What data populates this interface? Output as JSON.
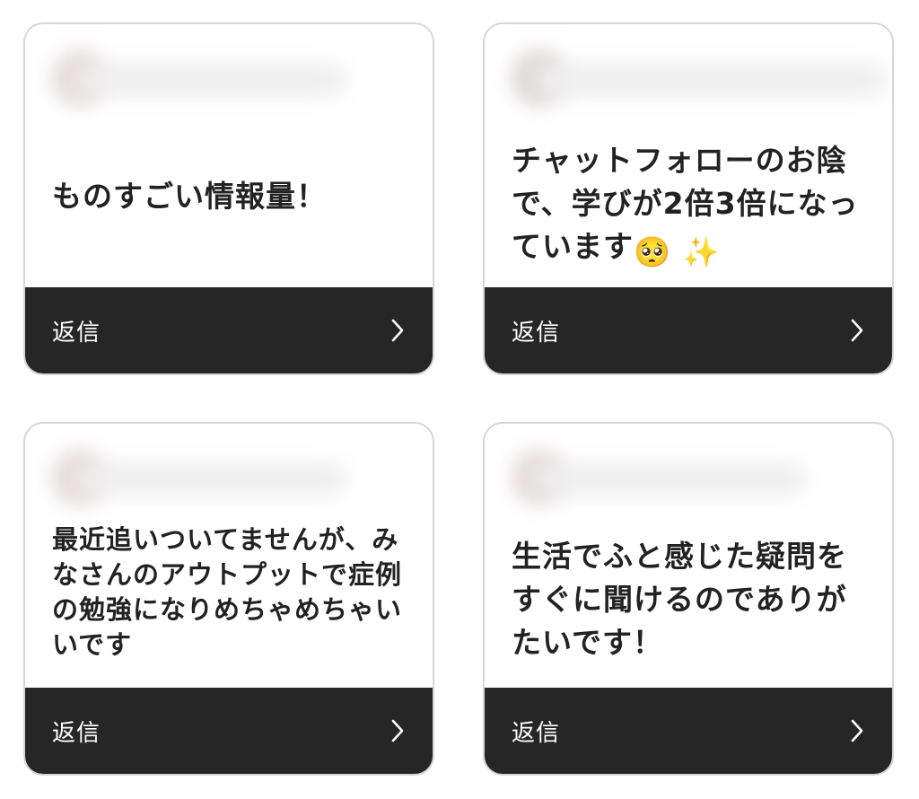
{
  "cards": [
    {
      "message": "ものすごい情報量！",
      "reply_label": "返信"
    },
    {
      "message_text": "チャットフォローのお陰で、学びが2倍3倍になっています",
      "emojis": [
        "🥺",
        "✨"
      ],
      "reply_label": "返信"
    },
    {
      "message": "最近追いついてませんが、みなさんのアウトプットで症例の勉強になりめちゃめちゃいいです",
      "reply_label": "返信"
    },
    {
      "message": "生活でふと感じた疑問をすぐに聞けるのでありがたいです！",
      "reply_label": "返信"
    }
  ]
}
